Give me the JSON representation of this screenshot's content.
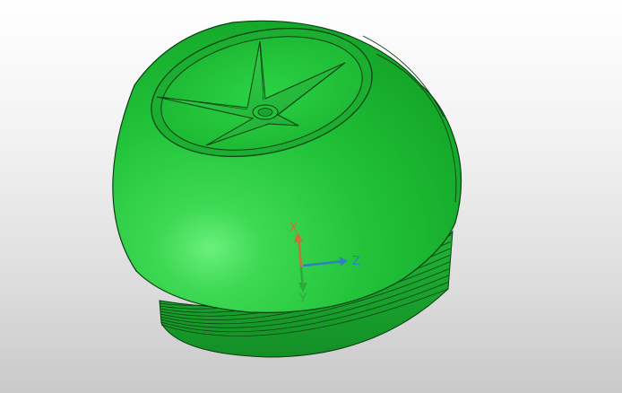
{
  "viewport": {
    "background_top": "#ffffff",
    "background_bottom": "#c9c9c9"
  },
  "model": {
    "body_color": "#22c33a",
    "edge_color": "#0b3d12",
    "thread_color": "#1aa52f",
    "highlight_color": "#66ee7a"
  },
  "triad": {
    "x_label": "X",
    "y_label": "Y",
    "z_label": "Z",
    "x_color": "#c8733a",
    "y_color": "#2fa83b",
    "z_color": "#2f7fc8"
  }
}
